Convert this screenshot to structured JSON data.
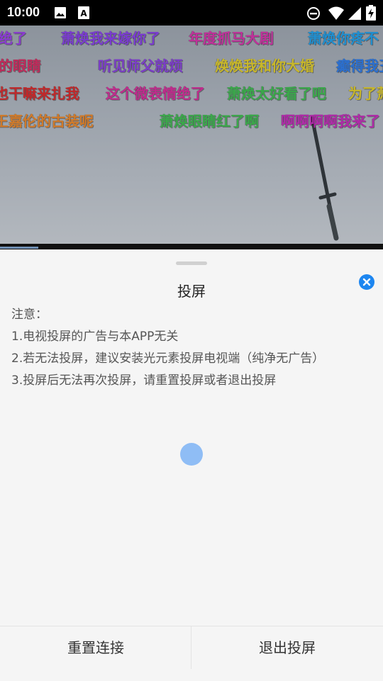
{
  "status_bar": {
    "time": "10:00",
    "icons": [
      "image-icon",
      "text-a-icon",
      "do-not-disturb-icon",
      "wifi-icon",
      "cell-signal-icon",
      "battery-charging-icon"
    ]
  },
  "video": {
    "danmaku": [
      {
        "text": "绝了",
        "color": "#8a3bd0"
      },
      {
        "text": "萧焕我来嫁你了",
        "color": "#7a3bd0"
      },
      {
        "text": "年度抓马大剧",
        "color": "#c0309a"
      },
      {
        "text": "萧焕你疼不",
        "color": "#1f8fd0"
      },
      {
        "text": "的眼睛",
        "color": "#c02a5a"
      },
      {
        "text": "听见师父就烦",
        "color": "#7b3cc8"
      },
      {
        "text": "焕焕我和你大婚",
        "color": "#c8b72a"
      },
      {
        "text": "癫得我丑",
        "color": "#2a6fd0"
      },
      {
        "text": "也干嘛来扎我",
        "color": "#c0282a"
      },
      {
        "text": "这个微表情绝了",
        "color": "#c02a8c"
      },
      {
        "text": "萧焕太好看了吧",
        "color": "#3aa84a"
      },
      {
        "text": "为了萧",
        "color": "#c8b72a"
      },
      {
        "text": "王嘉伦的古装呢",
        "color": "#d07a2a"
      },
      {
        "text": "萧焕眼睛红了啊",
        "color": "#3aa84a"
      },
      {
        "text": "啊啊啊啊我来了",
        "color": "#b02aa8"
      }
    ]
  },
  "sheet": {
    "title": "投屏",
    "notes": [
      "注意：",
      "1.电视投屏的广告与本APP无关",
      "2.若无法投屏，建议安装光元素投屏电视端（纯净无广告）",
      "3.投屏后无法再次投屏，请重置投屏或者退出投屏"
    ],
    "footer": {
      "reset_label": "重置连接",
      "exit_label": "退出投屏"
    }
  },
  "colors": {
    "accent": "#1d86f0",
    "spinner": "#8fbdf5"
  }
}
